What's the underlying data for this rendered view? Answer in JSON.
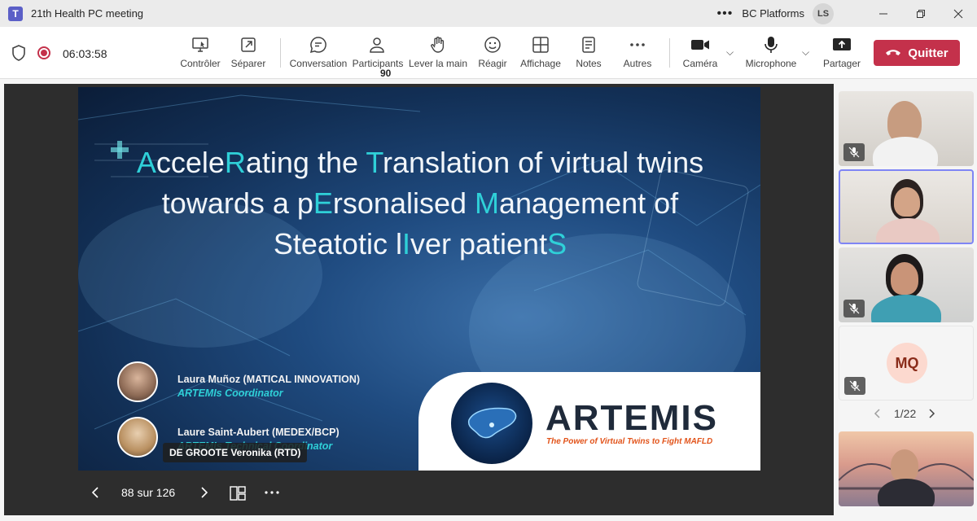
{
  "window": {
    "title": "21th Health PC meeting",
    "org": "BC Platforms",
    "user_initials": "LS",
    "minimize_icon": "minimize-icon",
    "maximize_icon": "restore-icon",
    "close_icon": "close-icon"
  },
  "toolbar": {
    "timer": "06:03:58",
    "buttons": {
      "controler": "Contrôler",
      "separer": "Séparer",
      "conversation": "Conversation",
      "participants": "Participants",
      "participants_count": "90",
      "lever": "Lever la main",
      "reagir": "Réagir",
      "affichage": "Affichage",
      "notes": "Notes",
      "autres": "Autres",
      "camera": "Caméra",
      "microphone": "Microphone",
      "partager": "Partager"
    },
    "quit_label": "Quitter",
    "colors": {
      "quit": "#c4314b",
      "accent": "#5b5fc7"
    }
  },
  "slide": {
    "title_parts": [
      {
        "t": "A",
        "h": true
      },
      {
        "t": "ccele",
        "h": false
      },
      {
        "t": "R",
        "h": true
      },
      {
        "t": "ating the ",
        "h": false
      },
      {
        "t": "T",
        "h": true
      },
      {
        "t": "ranslation of virtual twins towards a p",
        "h": false
      },
      {
        "t": "E",
        "h": true
      },
      {
        "t": "rsonalised ",
        "h": false
      },
      {
        "t": "M",
        "h": true
      },
      {
        "t": "anagement of Steatotic l",
        "h": false
      },
      {
        "t": "I",
        "h": true
      },
      {
        "t": "ver patient",
        "h": false
      },
      {
        "t": "S",
        "h": true
      }
    ],
    "speakers": [
      {
        "name": "Laura Muñoz (MATICAL INNOVATION)",
        "role": "ARTEMIs Coordinator"
      },
      {
        "name": "Laure Saint-Aubert (MEDEX/BCP)",
        "role": "ARTEMIs Technical Coordinator"
      }
    ],
    "logo_word": "ARTEMIS",
    "logo_tagline": "The Power of Virtual Twins to Fight MAFLD",
    "presenter_label": "DE GROOTE Veronika (RTD)",
    "page_indicator": "88 sur 126"
  },
  "gallery": {
    "mq_initials": "MQ",
    "pager": "1/22"
  }
}
